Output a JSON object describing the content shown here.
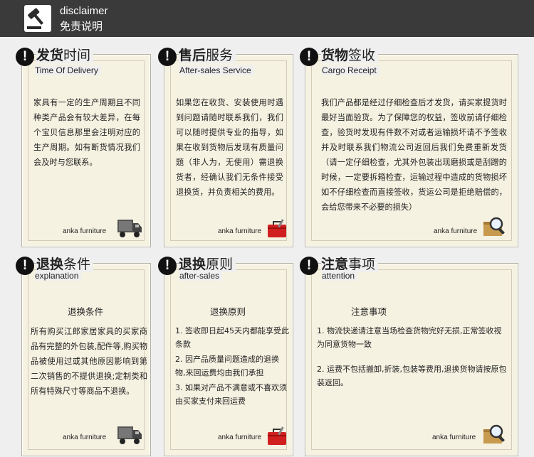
{
  "header": {
    "title_en": "disclaimer",
    "title_cn": "免责说明"
  },
  "cards": [
    {
      "title_bold": "发货",
      "title_light": "时间",
      "subtitle": "Time Of Delivery",
      "body": "家具有一定的生产周期且不同种类产品会有较大差异，在每个宝贝信息那里会注明对应的生产周期。如有断货情况我们会及时与您联系。",
      "brand": "anka furniture",
      "logo": "truck-icon"
    },
    {
      "title_bold": "售后",
      "title_light": "服务",
      "subtitle": "After-sales Service",
      "body": "如果您在收货、安装使用时遇到问题请随时联系我们，我们可以随时提供专业的指导，如果在收到货物后发现有质量问题（非人为，无使用）需退换货者，经确认我们无条件接受退换货，并负责相关的费用。",
      "brand": "anka furniture",
      "logo": "toolbox-icon"
    },
    {
      "title_bold": "货物",
      "title_light": "签收",
      "subtitle": "Cargo Receipt",
      "body": "我们产品都是经过仔细检查后才发货，请买家提货时最好当面验货。为了保障您的权益，签收前请仔细检查，验货时发现有件数不对或者运输损坏请不予签收并及时联系我们物流公司返回后我们免费重新发货（请一定仔细检查，尤其外包装出现磨损或是刮蹭的时候，一定要拆箱检查，运输过程中造成的货物损坏如不仔细检查而直接签收，货运公司是拒绝赔偿的，会给您带来不必要的损失）",
      "brand": "anka furniture",
      "logo": "magnifier-box-icon"
    },
    {
      "title_bold": "退换",
      "title_light": "条件",
      "subtitle": "explanation",
      "heading": "退换条件",
      "body": "所有购买江郎家居家具的买家商品有完整的外包装,配件等,购买物品被使用过或其他原因影响到第二次销售的不提供退换;定制类和所有特殊尺寸等商品不退换。",
      "brand": "anka furniture",
      "logo": "truck-icon"
    },
    {
      "title_bold": "退换",
      "title_light": "原则",
      "subtitle": "after-sales",
      "heading": "退换原则",
      "items": [
        "1. 签收即日起45天内都能享受此条款",
        "2. 因产品质量问题造成的退换物,来回运费均由我们承担",
        "3. 如果对产品不满意或不喜欢须由买家支付来回运费"
      ],
      "brand": "anka furniture",
      "logo": "toolbox-icon"
    },
    {
      "title_bold": "注意",
      "title_light": "事项",
      "subtitle": "attention",
      "heading": "注意事项",
      "items": [
        "1. 物流快递请注意当场检查货物完好无损,正常签收视为同意货物一致",
        "2. 运费不包括搬卸,折装,包装等费用,退换货物请按原包装返回。"
      ],
      "brand": "anka furniture",
      "logo": "magnifier-box-icon"
    }
  ]
}
